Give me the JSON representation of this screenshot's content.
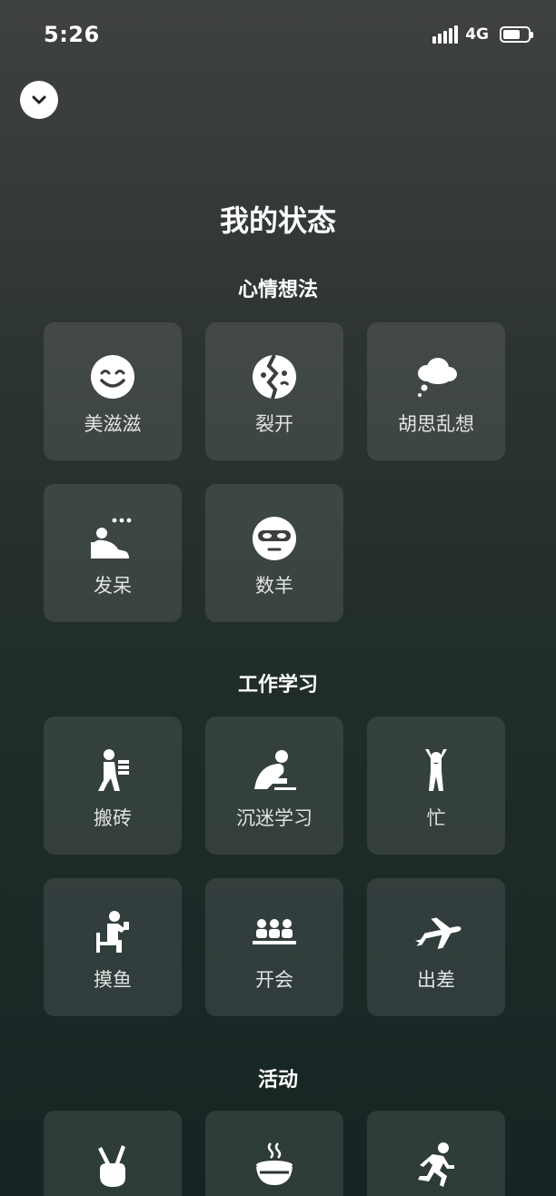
{
  "status_bar": {
    "time": "5:26",
    "network": "4G",
    "battery_level": 0.7
  },
  "page": {
    "title": "我的状态"
  },
  "sections": [
    {
      "title": "心情想法",
      "items": [
        {
          "label": "美滋滋",
          "icon": "smile-face-icon"
        },
        {
          "label": "裂开",
          "icon": "cracked-face-icon"
        },
        {
          "label": "胡思乱想",
          "icon": "thought-cloud-icon"
        },
        {
          "label": "发呆",
          "icon": "daze-person-icon"
        },
        {
          "label": "数羊",
          "icon": "sleep-mask-face-icon"
        }
      ]
    },
    {
      "title": "工作学习",
      "items": [
        {
          "label": "搬砖",
          "icon": "carry-bricks-icon"
        },
        {
          "label": "沉迷学习",
          "icon": "studying-person-icon"
        },
        {
          "label": "忙",
          "icon": "busy-person-icon"
        },
        {
          "label": "摸鱼",
          "icon": "slacking-person-icon"
        },
        {
          "label": "开会",
          "icon": "meeting-icon"
        },
        {
          "label": "出差",
          "icon": "airplane-icon"
        }
      ]
    },
    {
      "title": "活动",
      "items": [
        {
          "label": "",
          "icon": "victory-hand-icon"
        },
        {
          "label": "",
          "icon": "hot-bowl-icon"
        },
        {
          "label": "",
          "icon": "running-person-icon"
        }
      ]
    }
  ]
}
